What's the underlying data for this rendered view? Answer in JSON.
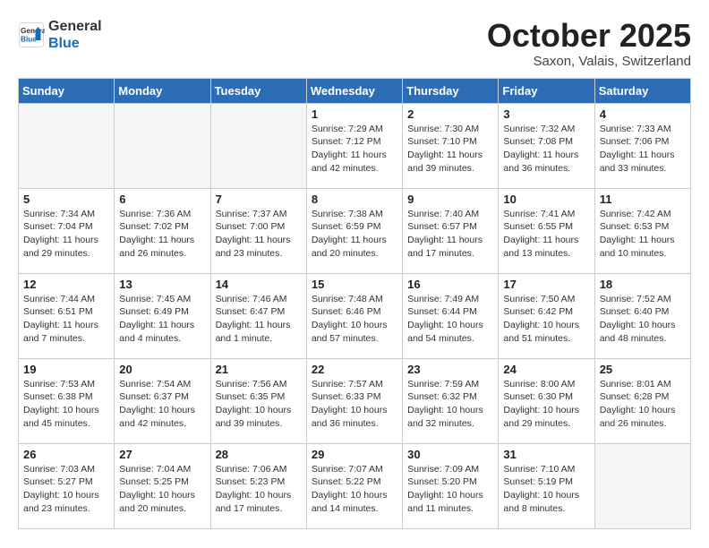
{
  "header": {
    "logo_line1": "General",
    "logo_line2": "Blue",
    "month": "October 2025",
    "location": "Saxon, Valais, Switzerland"
  },
  "weekdays": [
    "Sunday",
    "Monday",
    "Tuesday",
    "Wednesday",
    "Thursday",
    "Friday",
    "Saturday"
  ],
  "weeks": [
    [
      {
        "day": "",
        "sunrise": "",
        "sunset": "",
        "daylight": "",
        "empty": true
      },
      {
        "day": "",
        "sunrise": "",
        "sunset": "",
        "daylight": "",
        "empty": true
      },
      {
        "day": "",
        "sunrise": "",
        "sunset": "",
        "daylight": "",
        "empty": true
      },
      {
        "day": "1",
        "sunrise": "Sunrise: 7:29 AM",
        "sunset": "Sunset: 7:12 PM",
        "daylight": "Daylight: 11 hours and 42 minutes."
      },
      {
        "day": "2",
        "sunrise": "Sunrise: 7:30 AM",
        "sunset": "Sunset: 7:10 PM",
        "daylight": "Daylight: 11 hours and 39 minutes."
      },
      {
        "day": "3",
        "sunrise": "Sunrise: 7:32 AM",
        "sunset": "Sunset: 7:08 PM",
        "daylight": "Daylight: 11 hours and 36 minutes."
      },
      {
        "day": "4",
        "sunrise": "Sunrise: 7:33 AM",
        "sunset": "Sunset: 7:06 PM",
        "daylight": "Daylight: 11 hours and 33 minutes."
      }
    ],
    [
      {
        "day": "5",
        "sunrise": "Sunrise: 7:34 AM",
        "sunset": "Sunset: 7:04 PM",
        "daylight": "Daylight: 11 hours and 29 minutes."
      },
      {
        "day": "6",
        "sunrise": "Sunrise: 7:36 AM",
        "sunset": "Sunset: 7:02 PM",
        "daylight": "Daylight: 11 hours and 26 minutes."
      },
      {
        "day": "7",
        "sunrise": "Sunrise: 7:37 AM",
        "sunset": "Sunset: 7:00 PM",
        "daylight": "Daylight: 11 hours and 23 minutes."
      },
      {
        "day": "8",
        "sunrise": "Sunrise: 7:38 AM",
        "sunset": "Sunset: 6:59 PM",
        "daylight": "Daylight: 11 hours and 20 minutes."
      },
      {
        "day": "9",
        "sunrise": "Sunrise: 7:40 AM",
        "sunset": "Sunset: 6:57 PM",
        "daylight": "Daylight: 11 hours and 17 minutes."
      },
      {
        "day": "10",
        "sunrise": "Sunrise: 7:41 AM",
        "sunset": "Sunset: 6:55 PM",
        "daylight": "Daylight: 11 hours and 13 minutes."
      },
      {
        "day": "11",
        "sunrise": "Sunrise: 7:42 AM",
        "sunset": "Sunset: 6:53 PM",
        "daylight": "Daylight: 11 hours and 10 minutes."
      }
    ],
    [
      {
        "day": "12",
        "sunrise": "Sunrise: 7:44 AM",
        "sunset": "Sunset: 6:51 PM",
        "daylight": "Daylight: 11 hours and 7 minutes."
      },
      {
        "day": "13",
        "sunrise": "Sunrise: 7:45 AM",
        "sunset": "Sunset: 6:49 PM",
        "daylight": "Daylight: 11 hours and 4 minutes."
      },
      {
        "day": "14",
        "sunrise": "Sunrise: 7:46 AM",
        "sunset": "Sunset: 6:47 PM",
        "daylight": "Daylight: 11 hours and 1 minute."
      },
      {
        "day": "15",
        "sunrise": "Sunrise: 7:48 AM",
        "sunset": "Sunset: 6:46 PM",
        "daylight": "Daylight: 10 hours and 57 minutes."
      },
      {
        "day": "16",
        "sunrise": "Sunrise: 7:49 AM",
        "sunset": "Sunset: 6:44 PM",
        "daylight": "Daylight: 10 hours and 54 minutes."
      },
      {
        "day": "17",
        "sunrise": "Sunrise: 7:50 AM",
        "sunset": "Sunset: 6:42 PM",
        "daylight": "Daylight: 10 hours and 51 minutes."
      },
      {
        "day": "18",
        "sunrise": "Sunrise: 7:52 AM",
        "sunset": "Sunset: 6:40 PM",
        "daylight": "Daylight: 10 hours and 48 minutes."
      }
    ],
    [
      {
        "day": "19",
        "sunrise": "Sunrise: 7:53 AM",
        "sunset": "Sunset: 6:38 PM",
        "daylight": "Daylight: 10 hours and 45 minutes."
      },
      {
        "day": "20",
        "sunrise": "Sunrise: 7:54 AM",
        "sunset": "Sunset: 6:37 PM",
        "daylight": "Daylight: 10 hours and 42 minutes."
      },
      {
        "day": "21",
        "sunrise": "Sunrise: 7:56 AM",
        "sunset": "Sunset: 6:35 PM",
        "daylight": "Daylight: 10 hours and 39 minutes."
      },
      {
        "day": "22",
        "sunrise": "Sunrise: 7:57 AM",
        "sunset": "Sunset: 6:33 PM",
        "daylight": "Daylight: 10 hours and 36 minutes."
      },
      {
        "day": "23",
        "sunrise": "Sunrise: 7:59 AM",
        "sunset": "Sunset: 6:32 PM",
        "daylight": "Daylight: 10 hours and 32 minutes."
      },
      {
        "day": "24",
        "sunrise": "Sunrise: 8:00 AM",
        "sunset": "Sunset: 6:30 PM",
        "daylight": "Daylight: 10 hours and 29 minutes."
      },
      {
        "day": "25",
        "sunrise": "Sunrise: 8:01 AM",
        "sunset": "Sunset: 6:28 PM",
        "daylight": "Daylight: 10 hours and 26 minutes."
      }
    ],
    [
      {
        "day": "26",
        "sunrise": "Sunrise: 7:03 AM",
        "sunset": "Sunset: 5:27 PM",
        "daylight": "Daylight: 10 hours and 23 minutes."
      },
      {
        "day": "27",
        "sunrise": "Sunrise: 7:04 AM",
        "sunset": "Sunset: 5:25 PM",
        "daylight": "Daylight: 10 hours and 20 minutes."
      },
      {
        "day": "28",
        "sunrise": "Sunrise: 7:06 AM",
        "sunset": "Sunset: 5:23 PM",
        "daylight": "Daylight: 10 hours and 17 minutes."
      },
      {
        "day": "29",
        "sunrise": "Sunrise: 7:07 AM",
        "sunset": "Sunset: 5:22 PM",
        "daylight": "Daylight: 10 hours and 14 minutes."
      },
      {
        "day": "30",
        "sunrise": "Sunrise: 7:09 AM",
        "sunset": "Sunset: 5:20 PM",
        "daylight": "Daylight: 10 hours and 11 minutes."
      },
      {
        "day": "31",
        "sunrise": "Sunrise: 7:10 AM",
        "sunset": "Sunset: 5:19 PM",
        "daylight": "Daylight: 10 hours and 8 minutes."
      },
      {
        "day": "",
        "sunrise": "",
        "sunset": "",
        "daylight": "",
        "empty": true
      }
    ]
  ]
}
